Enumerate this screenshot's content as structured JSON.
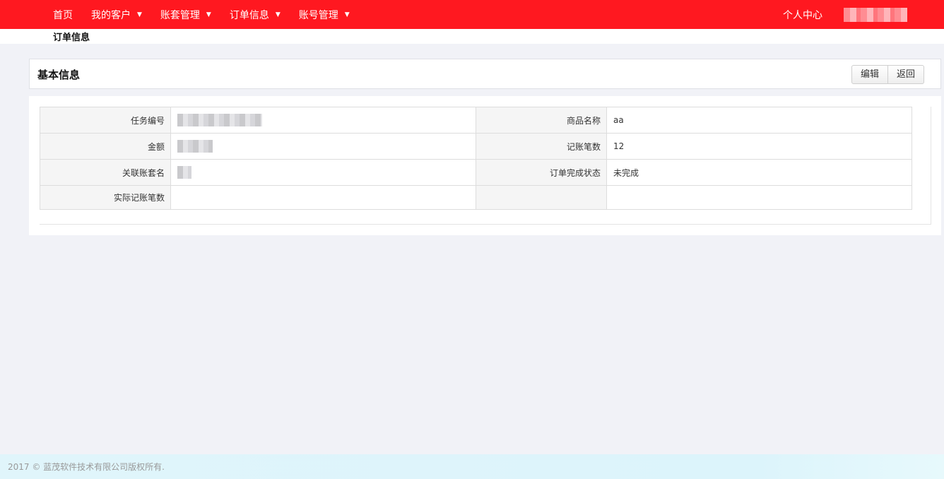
{
  "nav": {
    "items": [
      {
        "label": "首页",
        "dropdown": false
      },
      {
        "label": "我的客户",
        "dropdown": true
      },
      {
        "label": "账套管理",
        "dropdown": true
      },
      {
        "label": "订单信息",
        "dropdown": true
      },
      {
        "label": "账号管理",
        "dropdown": true
      }
    ],
    "caret": "▼",
    "user_center": "个人中心"
  },
  "breadcrumb": {
    "current": "订单信息"
  },
  "section": {
    "title": "基本信息"
  },
  "buttons": {
    "edit": "编辑",
    "back": "返回"
  },
  "info": {
    "rows": [
      {
        "label_left": "任务编号",
        "value_left": "",
        "label_right": "商品名称",
        "value_right": "aa"
      },
      {
        "label_left": "金额",
        "value_left": "",
        "label_right": "记账笔数",
        "value_right": "12"
      },
      {
        "label_left": "关联账套名",
        "value_left": "",
        "label_right": "订单完成状态",
        "value_right": "未完成"
      },
      {
        "label_left": "实际记账笔数",
        "value_left": "",
        "label_right": "",
        "value_right": ""
      }
    ]
  },
  "footer": {
    "copyright": "2017 © 蓝茂软件技术有限公司版权所有."
  },
  "colors": {
    "topbar": "#ff1820",
    "page_bg": "#f1f2f7",
    "footer_bg": "#dcf4fb"
  }
}
